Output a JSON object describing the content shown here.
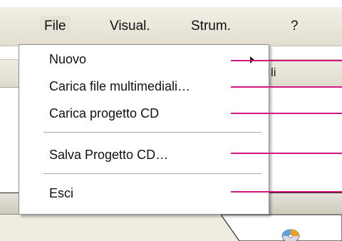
{
  "menubar": {
    "items": [
      {
        "label": "File"
      },
      {
        "label": "Visual."
      },
      {
        "label": "Strum."
      },
      {
        "label": "?"
      }
    ]
  },
  "background_panel": {
    "header_fragment": "li"
  },
  "file_menu": {
    "items": [
      {
        "label": "Nuovo",
        "has_submenu": true
      },
      {
        "label": "Carica file multimediali…"
      },
      {
        "label": "Carica progetto CD"
      },
      {
        "label": "Salva Progetto CD…"
      },
      {
        "label": "Esci"
      }
    ]
  },
  "colors": {
    "callout": "#d4187d",
    "menubar": "#e8e5d8",
    "menu_background": "#ffffff"
  },
  "icons": {
    "submenu": "submenu-arrow-icon",
    "taskbar": "cd-disc-icon"
  }
}
